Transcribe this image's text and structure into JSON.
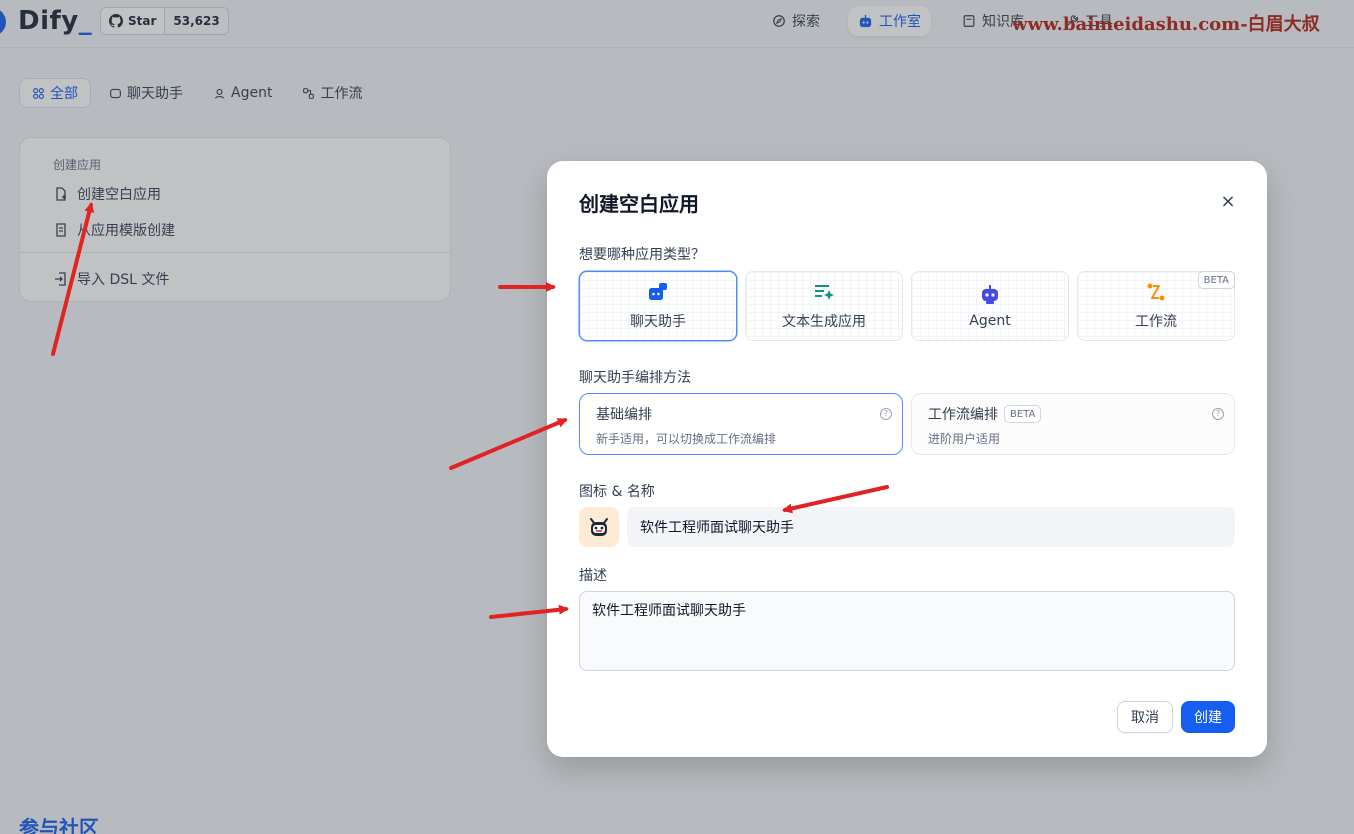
{
  "topbar": {
    "logo_text": "Dify",
    "logo_cursor": "_",
    "star_label": "Star",
    "star_count": "53,623",
    "nav": [
      {
        "label": "探索",
        "icon": "compass-icon"
      },
      {
        "label": "工作室",
        "icon": "robot-icon"
      },
      {
        "label": "知识库",
        "icon": "book-icon"
      },
      {
        "label": "工具",
        "icon": "tools-icon"
      }
    ],
    "watermark": "www.baimeidashu.com-白眉大叔"
  },
  "filters": [
    {
      "label": "全部",
      "icon": "grid-icon"
    },
    {
      "label": "聊天助手",
      "icon": "chat-icon"
    },
    {
      "label": "Agent",
      "icon": "agent-icon"
    },
    {
      "label": "工作流",
      "icon": "workflow-icon"
    }
  ],
  "create_card": {
    "header": "创建应用",
    "blank": "创建空白应用",
    "template": "从应用模版创建",
    "import": "导入 DSL 文件"
  },
  "community": "参与社区",
  "modal": {
    "title": "创建空白应用",
    "close": "×",
    "type_question": "想要哪种应用类型？",
    "types": [
      {
        "label": "聊天助手",
        "icon": "chatbot-icon",
        "color": "#155eef"
      },
      {
        "label": "文本生成应用",
        "icon": "text-generation-icon",
        "color": "#0e9384"
      },
      {
        "label": "Agent",
        "icon": "agent-robot-icon",
        "color": "#444ce7"
      },
      {
        "label": "工作流",
        "icon": "workflow-icon",
        "color": "#f79009",
        "badge": "BETA"
      }
    ],
    "mode_label": "聊天助手编排方法",
    "modes": [
      {
        "title": "基础编排",
        "desc": "新手适用，可以切换成工作流编排"
      },
      {
        "title": "工作流编排",
        "badge": "BETA",
        "desc": "进阶用户适用"
      }
    ],
    "help_glyph": "?",
    "name_label": "图标 & 名称",
    "name_value": "软件工程师面试聊天助手",
    "desc_label": "描述",
    "desc_value": "软件工程师面试聊天助手",
    "cancel": "取消",
    "create": "创建"
  },
  "colors": {
    "accent": "#155eef",
    "arrow": "#e02424",
    "watermark": "#b42318"
  }
}
